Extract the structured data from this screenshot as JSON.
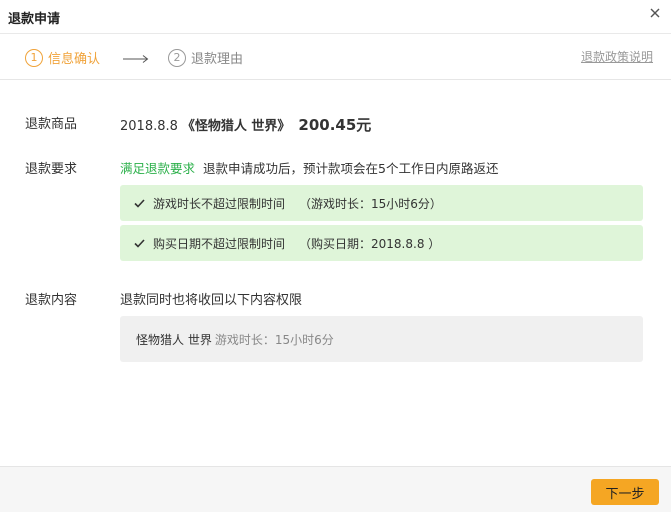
{
  "dialog": {
    "title": "退款申请",
    "close_icon": "close-icon"
  },
  "steps": {
    "step1": {
      "number": "1",
      "label": "信息确认",
      "state": "active"
    },
    "step2": {
      "number": "2",
      "label": "退款理由",
      "state": "pending"
    },
    "policy_link": "退款政策说明"
  },
  "product": {
    "label": "退款商品",
    "date": "2018.8.8",
    "name": "《怪物猎人 世界》",
    "price": "200.45元"
  },
  "requirement": {
    "label": "退款要求",
    "status": "满足退款要求",
    "description": "退款申请成功后，预计款项会在5个工作日内原路返还",
    "conditions": [
      {
        "text": "游戏时长不超过限制时间",
        "detail": "（游戏时长：15小时6分）"
      },
      {
        "text": "购买日期不超过限制时间",
        "detail": "（购买日期：2018.8.8 ）"
      }
    ]
  },
  "content": {
    "label": "退款内容",
    "text": "退款同时也将收回以下内容权限",
    "item_name": "怪物猎人 世界",
    "item_playtime": "游戏时长：15小时6分"
  },
  "footer": {
    "next_label": "下一步"
  },
  "colors": {
    "accent": "#f0a33a",
    "success": "#2bb04a",
    "success_bg": "#dff5d9",
    "button": "#f5a623"
  }
}
